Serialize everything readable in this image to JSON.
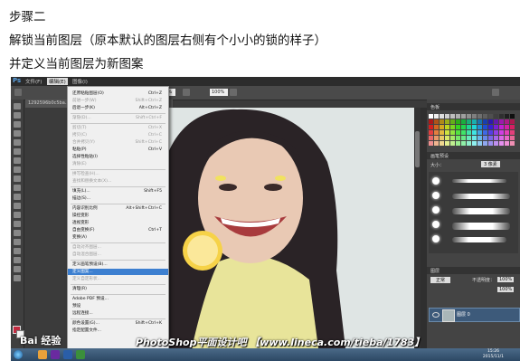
{
  "captions": {
    "line1": "步骤二",
    "line2": "解锁当前图层（原本默认的图层右侧有个小小的锁的样子）",
    "line3": "并定义当前图层为新图案"
  },
  "photoshop": {
    "logo": "Ps",
    "menus": [
      "文件(F)",
      "编辑(E)",
      "图像(I)"
    ],
    "options": {
      "zoom1": "100%",
      "zoom2": "100%"
    },
    "doc_tab": "1292596b0c5ba...",
    "edit_menu": [
      {
        "label": "还原粘贴图层(O)",
        "shortcut": "Ctrl+Z",
        "disabled": false
      },
      {
        "label": "前进一步(W)",
        "shortcut": "Shift+Ctrl+Z",
        "disabled": true
      },
      {
        "label": "后退一步(K)",
        "shortcut": "Alt+Ctrl+Z",
        "disabled": false
      },
      {
        "label": "渐隐(D)...",
        "shortcut": "Shift+Ctrl+F",
        "disabled": true
      },
      {
        "label": "剪切(T)",
        "shortcut": "Ctrl+X",
        "disabled": true
      },
      {
        "label": "拷贝(C)",
        "shortcut": "Ctrl+C",
        "disabled": true
      },
      {
        "label": "合并拷贝(Y)",
        "shortcut": "Shift+Ctrl+C",
        "disabled": true
      },
      {
        "label": "粘贴(P)",
        "shortcut": "Ctrl+V",
        "disabled": false
      },
      {
        "label": "选择性粘贴(I)",
        "shortcut": "",
        "disabled": false
      },
      {
        "label": "清除(E)",
        "shortcut": "",
        "disabled": true
      },
      {
        "label": "拼写检查(H)...",
        "shortcut": "",
        "disabled": true
      },
      {
        "label": "查找和替换文本(X)...",
        "shortcut": "",
        "disabled": true
      },
      {
        "label": "填充(L)...",
        "shortcut": "Shift+F5",
        "disabled": false
      },
      {
        "label": "描边(S)...",
        "shortcut": "",
        "disabled": false
      },
      {
        "label": "内容识别比例",
        "shortcut": "Alt+Shift+Ctrl+C",
        "disabled": false
      },
      {
        "label": "操控变形",
        "shortcut": "",
        "disabled": false
      },
      {
        "label": "透视变形",
        "shortcut": "",
        "disabled": false
      },
      {
        "label": "自由变换(F)",
        "shortcut": "Ctrl+T",
        "disabled": false
      },
      {
        "label": "变换(A)",
        "shortcut": "",
        "disabled": false
      },
      {
        "label": "自动对齐图层...",
        "shortcut": "",
        "disabled": true
      },
      {
        "label": "自动混合图层...",
        "shortcut": "",
        "disabled": true
      },
      {
        "label": "定义画笔预设(B)...",
        "shortcut": "",
        "disabled": false
      },
      {
        "label": "定义图案...",
        "shortcut": "",
        "disabled": false,
        "highlighted": true
      },
      {
        "label": "定义自定形状...",
        "shortcut": "",
        "disabled": true
      },
      {
        "label": "清理(R)",
        "shortcut": "",
        "disabled": false
      },
      {
        "label": "Adobe PDF 预设...",
        "shortcut": "",
        "disabled": false
      },
      {
        "label": "预设",
        "shortcut": "",
        "disabled": false
      },
      {
        "label": "远程连接...",
        "shortcut": "",
        "disabled": false
      },
      {
        "label": "颜色设置(G)...",
        "shortcut": "Shift+Ctrl+K",
        "disabled": false
      },
      {
        "label": "指定配置文件...",
        "shortcut": "",
        "disabled": false
      }
    ],
    "panels": {
      "swatches_tab": "色板",
      "brush_tab": "画笔预设",
      "brush_size": "大小：",
      "brush_size_value": "3 像素",
      "layers_tab": "图层",
      "blend_mode": "正常",
      "opacity_label": "不透明度：",
      "opacity_value": "100%",
      "fill_value": "100%",
      "layer_name": "图层 0"
    },
    "taskbar": {
      "clock_time": "15:26",
      "clock_date": "2015/11/1"
    }
  },
  "watermark": {
    "logo": "Bai 经验",
    "text": "PhotoShop平面设计吧  【www.lineca.com/tieba/1783】"
  },
  "colors": {
    "menu_highlight": "#3c7fd0",
    "foreground": "#c32a40",
    "ps_background": "#3b3b3b"
  }
}
